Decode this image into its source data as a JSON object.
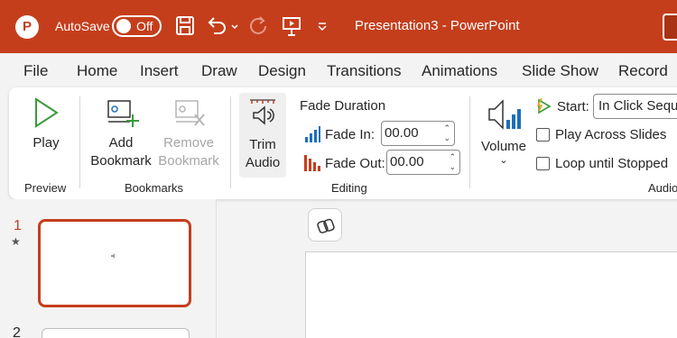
{
  "titlebar": {
    "autosave_label": "AutoSave",
    "autosave_state": "Off",
    "document_title": "Presentation3  -  PowerPoint",
    "logo_letter": "P"
  },
  "tabs": [
    "File",
    "Home",
    "Insert",
    "Draw",
    "Design",
    "Transitions",
    "Animations",
    "Slide Show",
    "Record"
  ],
  "ribbon": {
    "preview": {
      "play_label": "Play",
      "group_label": "Preview"
    },
    "bookmarks": {
      "add_label_1": "Add",
      "add_label_2": "Bookmark",
      "remove_label_1": "Remove",
      "remove_label_2": "Bookmark",
      "group_label": "Bookmarks"
    },
    "editing": {
      "trim_label_1": "Trim",
      "trim_label_2": "Audio",
      "fade_duration_label": "Fade Duration",
      "fade_in_label": "Fade In:",
      "fade_in_value": "00.00",
      "fade_out_label": "Fade Out:",
      "fade_out_value": "00.00",
      "group_label": "Editing"
    },
    "audio_options": {
      "volume_label": "Volume",
      "start_label": "Start:",
      "start_value": "In Click Seque",
      "play_across_label": "Play Across Slides",
      "loop_label": "Loop until Stopped",
      "group_label": "Audio"
    }
  },
  "slides": [
    {
      "number": "1",
      "marker": "★"
    },
    {
      "number": "2"
    }
  ],
  "colors": {
    "accent": "#c43e1c",
    "ribbon_bg": "#ffffff",
    "window_bg": "#f3f3f3",
    "play_green": "#3a9a3a"
  }
}
